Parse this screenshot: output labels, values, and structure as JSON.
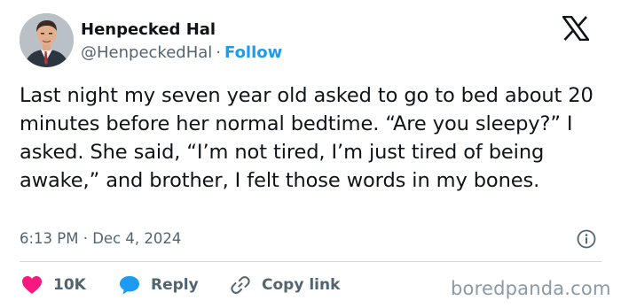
{
  "author": {
    "display_name": "Henpecked Hal",
    "handle": "@HenpeckedHal",
    "separator": "·",
    "follow_label": "Follow"
  },
  "tweet": {
    "text": "Last night my seven year old asked to go to bed about 20 minutes before her normal bedtime. “Are you sleepy?” I asked. She said, “I’m not tired, I’m just tired of being awake,” and brother, I felt those words in my bones.",
    "timestamp": "6:13 PM · Dec 4, 2024"
  },
  "actions": {
    "likes_count": "10K",
    "reply_label": "Reply",
    "copy_link_label": "Copy link"
  },
  "watermark": "boredpanda.com",
  "colors": {
    "accent": "#1d9bf0",
    "like": "#f91880",
    "text": "#0f1419",
    "secondary": "#536471"
  },
  "icons": [
    "x-logo-icon",
    "info-icon",
    "heart-icon",
    "reply-bubble-icon",
    "link-icon"
  ]
}
